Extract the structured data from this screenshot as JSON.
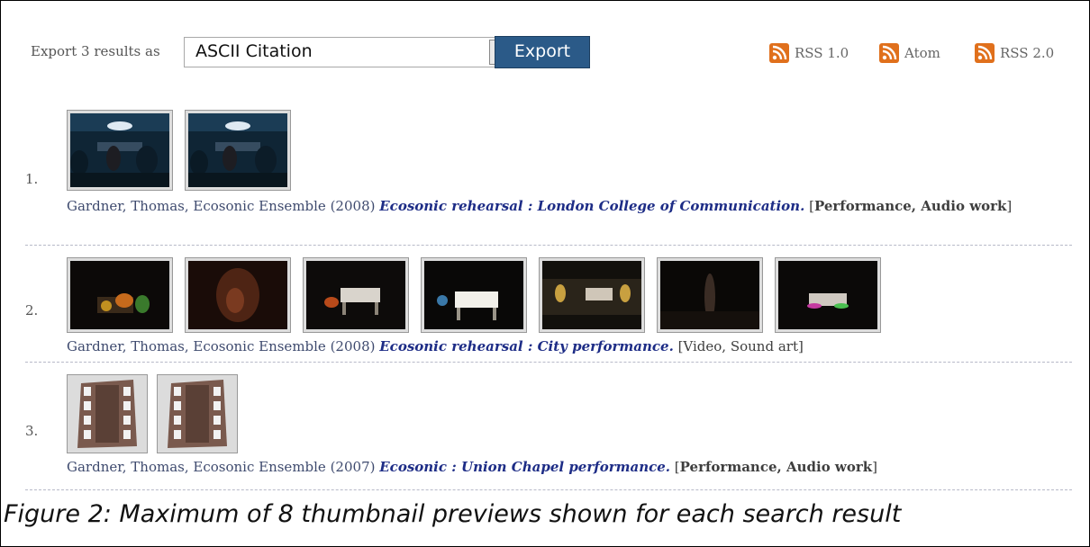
{
  "toolbar": {
    "export_label": "Export 3 results as",
    "format_select": {
      "value": "ASCII Citation"
    },
    "export_button": "Export"
  },
  "feeds": [
    {
      "label": "RSS 1.0",
      "icon": "rss-icon"
    },
    {
      "label": "Atom",
      "icon": "rss-icon"
    },
    {
      "label": "RSS 2.0",
      "icon": "rss-icon"
    }
  ],
  "results": [
    {
      "number": "1.",
      "thumb_style": "blue-photo",
      "thumb_count": 2,
      "authors": "Gardner, Thomas, Ecosonic Ensemble (2008)",
      "title": "Ecosonic rehearsal : London College of Communication.",
      "types_open": "[",
      "types_bold": "Performance, Audio work",
      "types_close": "]"
    },
    {
      "number": "2.",
      "thumb_style": "dark-photo",
      "thumb_count": 7,
      "authors": "Gardner, Thomas, Ecosonic Ensemble (2008)",
      "title": "Ecosonic rehearsal : City performance.",
      "types_open": "[Video, Sound art]",
      "types_bold": "",
      "types_close": ""
    },
    {
      "number": "3.",
      "thumb_style": "film-icon",
      "thumb_count": 2,
      "authors": "Gardner, Thomas, Ecosonic Ensemble (2007)",
      "title": "Ecosonic : Union Chapel performance.",
      "types_open": "[",
      "types_bold": "Performance, Audio work",
      "types_close": "]"
    }
  ],
  "caption": "Figure 2: Maximum of 8 thumbnail previews shown for each search result",
  "colors": {
    "export_button": "#2b5a88",
    "rss": "#e0701c",
    "title_link": "#1d2c86",
    "divider": "#b7b9c8"
  }
}
